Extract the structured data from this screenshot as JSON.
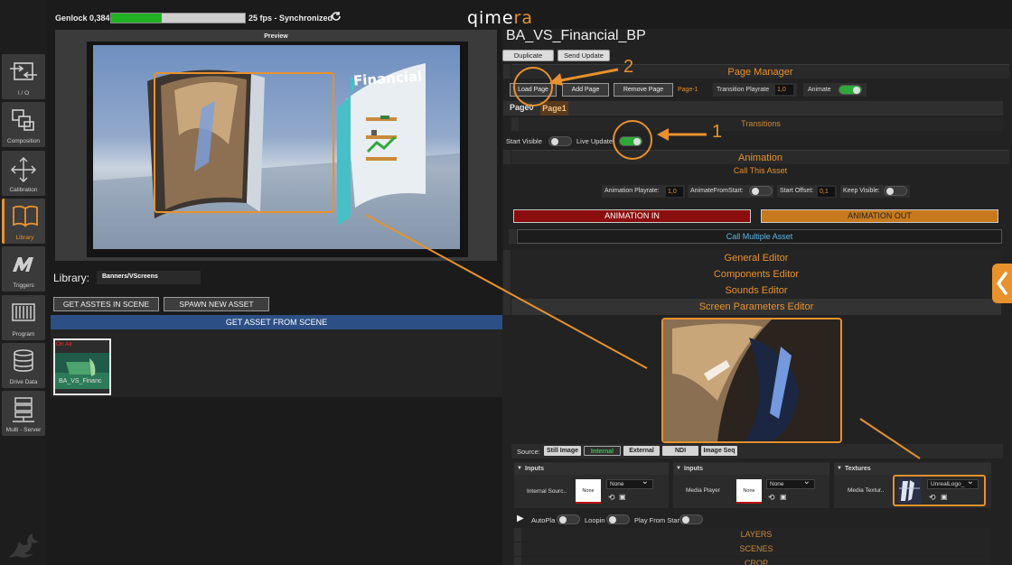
{
  "top_status": {
    "genlock_label": "Genlock 0,384",
    "genlock_level": 0.38,
    "fps_label": "25 fps - Synchronized"
  },
  "logo": {
    "text": "qimera",
    "brand_color": "#e8912d"
  },
  "sidebar": {
    "items": [
      {
        "label": "I / O",
        "icon": "io-icon"
      },
      {
        "label": "Composition",
        "icon": "composition-icon"
      },
      {
        "label": "Calibration",
        "icon": "calibration-icon"
      },
      {
        "label": "Library",
        "icon": "book-icon"
      },
      {
        "label": "Triggers",
        "icon": "triggers-icon"
      },
      {
        "label": "Program",
        "icon": "program-icon"
      },
      {
        "label": "Drive Data",
        "icon": "database-icon"
      },
      {
        "label": "Multi - Server",
        "icon": "server-icon"
      }
    ],
    "active": "Library"
  },
  "preview": {
    "title": "Preview",
    "scene_text": "Financial"
  },
  "library": {
    "label": "Library:",
    "path": "Banners/VScreens",
    "get_assets_btn": "GET ASSTES IN SCENE",
    "spawn_btn": "SPAWN NEW ASSET",
    "get_asset_from_scene": "GET ASSET FROM SCENE",
    "asset": {
      "status": "On Air",
      "name": "BA_VS_Financ"
    }
  },
  "asset_panel": {
    "title": "BA_VS_Financial_BP",
    "duplicate_btn": "Duplicate",
    "send_update_btn": "Send Update",
    "page_manager": {
      "title": "Page Manager",
      "load_page": "Load Page",
      "add_page": "Add Page",
      "remove_page": "Remove Page",
      "current_page": "Page-1",
      "transition_playrate_label": "Transition Playrate",
      "transition_playrate_value": "1,0",
      "animate_label": "Animate",
      "pages": [
        "Page0",
        "Page1"
      ],
      "transitions": "Transitions",
      "start_visible": "Start Visible",
      "live_update": "Live Update"
    },
    "animation": {
      "title": "Animation",
      "call_this_asset": "Call This Asset",
      "playrate_label": "Animation Playrate:",
      "playrate_value": "1,0",
      "animate_from_start": "AnimateFromStart:",
      "start_offset_label": "Start Offset:",
      "start_offset_value": "0,1",
      "keep_visible": "Keep Visible:",
      "anim_in": "ANIMATION IN",
      "anim_out": "ANIMATION OUT",
      "call_multiple": "Call Multiple Asset"
    },
    "editors": {
      "general": "General Editor",
      "components": "Components Editor",
      "sounds": "Sounds Editor",
      "screen_params": "Screen Parameters Editor"
    },
    "source": {
      "label": "Source:",
      "tabs": [
        "Still Image",
        "Internal",
        "External",
        "NDI",
        "Image Seq"
      ],
      "active": "Internal"
    },
    "panels": {
      "inputs1": {
        "head": "Inputs",
        "label": "Internal Sourc..",
        "swatch": "None",
        "dropdown": "None"
      },
      "inputs2": {
        "head": "Inputs",
        "label": "Media Player",
        "swatch": "None",
        "dropdown": "None"
      },
      "textures": {
        "head": "Textures",
        "label": "Media Textur..",
        "dropdown": "UnrealLogo_"
      }
    },
    "playback": {
      "autoplay": "AutoPla",
      "looping": "Loopin",
      "play_from_start": "Play From Star"
    },
    "bottom_sections": [
      "LAYERS",
      "SCENES",
      "CROP"
    ]
  },
  "annotations": {
    "marker_1": "1",
    "marker_2": "2"
  },
  "colors": {
    "accent": "#e8912d",
    "anim_in": "#8b0e0e",
    "anim_out": "#c77a1d",
    "toggle_on": "#2fa83a",
    "blue_bar": "#2c4f86"
  }
}
